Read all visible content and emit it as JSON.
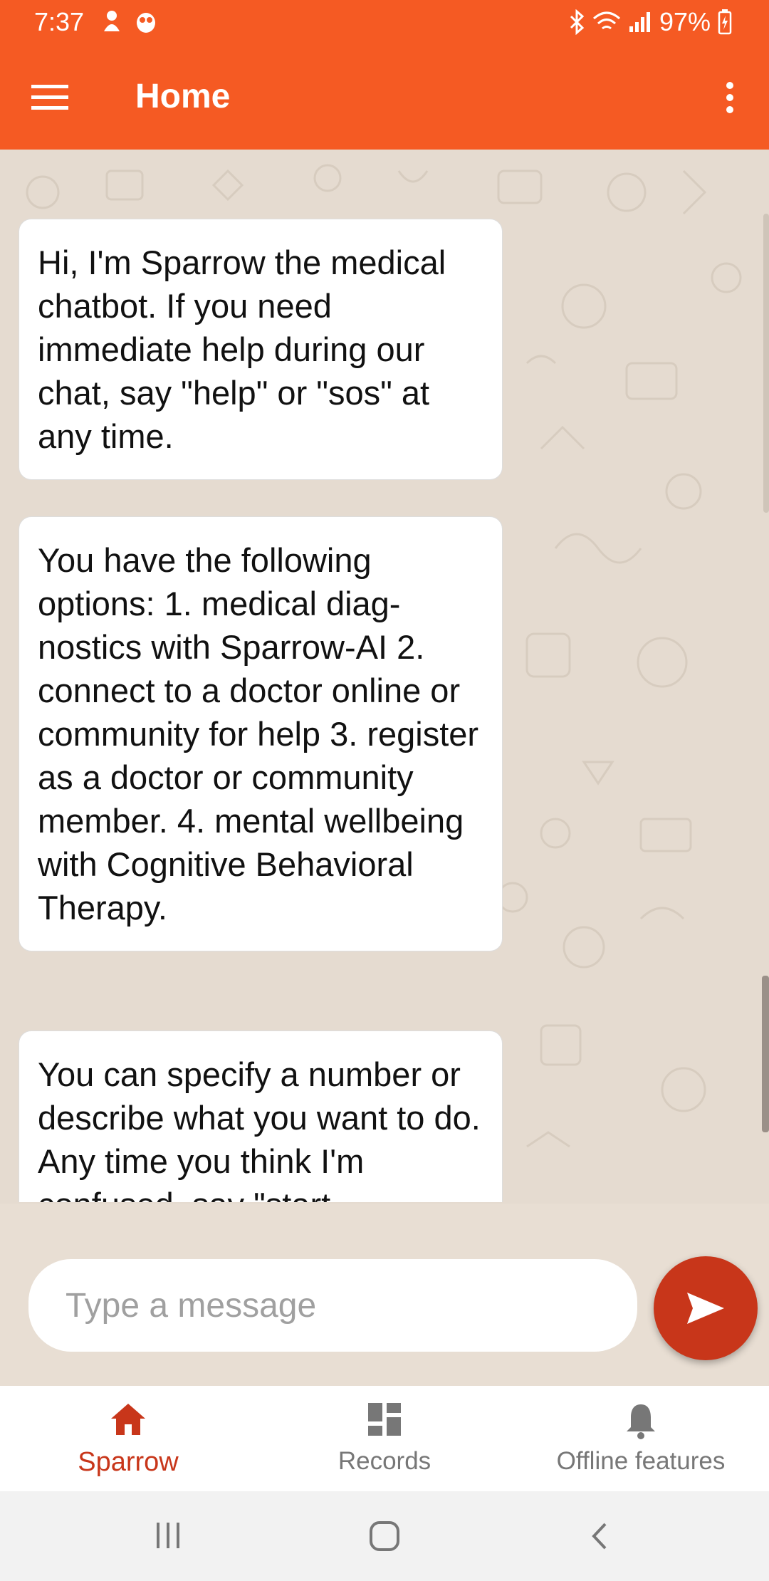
{
  "status_bar": {
    "time": "7:37",
    "battery": "97%"
  },
  "app_bar": {
    "title": "Home",
    "menu_icon": "hamburger-menu-icon",
    "overflow_icon": "more-vert-icon"
  },
  "chat": {
    "messages": [
      "Hi, I'm Sparrow the medical chatbot. If you need immediate help during our chat, say \"help\" or \"sos\" at any time.",
      " You have the following options: 1. medical diag-nostics with Sparrow-AI 2. connect to a doctor online or community for help 3. register as a doctor or community member. 4. mental wellbeing with Cognitive Behavioral Therapy.",
      "You can specify a number or describe what you want to do. Any time you think I'm confused, say \"start"
    ]
  },
  "composer": {
    "placeholder": "Type a message",
    "send_icon": "send-icon"
  },
  "bottom_nav": {
    "items": [
      {
        "label": "Sparrow",
        "icon": "home-icon",
        "active": true
      },
      {
        "label": "Records",
        "icon": "dashboard-icon",
        "active": false
      },
      {
        "label": "Offline features",
        "icon": "bell-icon",
        "active": false
      }
    ]
  },
  "colors": {
    "primary": "#f55a23",
    "accent": "#c8361a",
    "chat_bg": "#e5dbd0"
  }
}
